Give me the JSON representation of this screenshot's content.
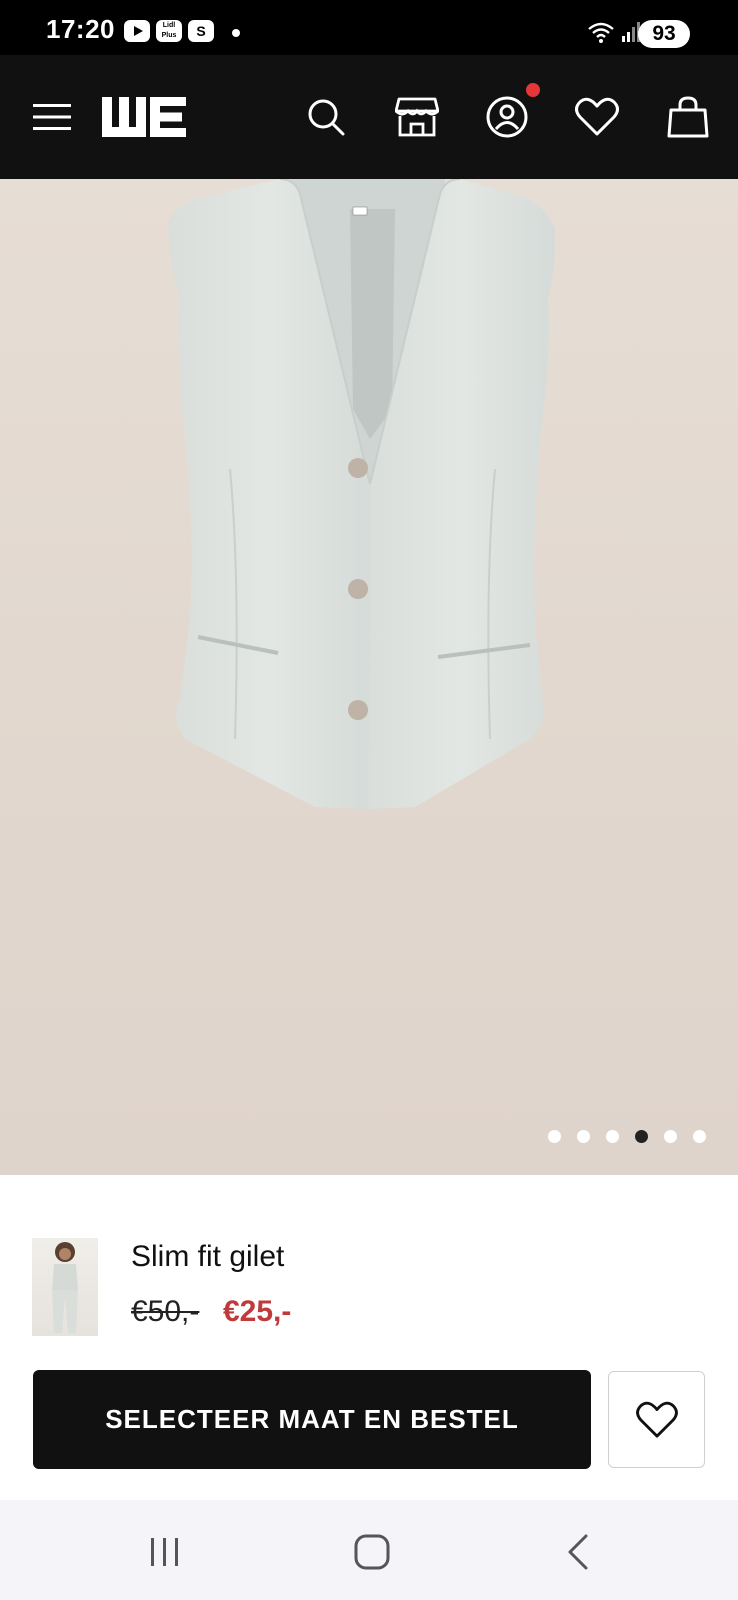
{
  "status_bar": {
    "time": "17:20",
    "battery": "93",
    "app_icons": [
      "youtube-icon",
      "lidl-plus-icon",
      "s-app-icon"
    ]
  },
  "header": {
    "logo": "WE",
    "icons": [
      "menu-icon",
      "search-icon",
      "store-icon",
      "account-icon",
      "heart-icon",
      "bag-icon"
    ]
  },
  "carousel": {
    "total": 6,
    "active": 4
  },
  "product": {
    "name": "Slim fit gilet",
    "old_price": "€50,-",
    "new_price": "€25,-"
  },
  "actions": {
    "order_label": "SELECTEER MAAT EN BESTEL"
  },
  "nav": {
    "icons": [
      "recent-apps-icon",
      "home-icon",
      "back-icon"
    ]
  },
  "colors": {
    "header_bg": "#111111",
    "price_sale": "#c0393b",
    "notification": "#e5373a",
    "image_bg": "#e2d8cf"
  }
}
